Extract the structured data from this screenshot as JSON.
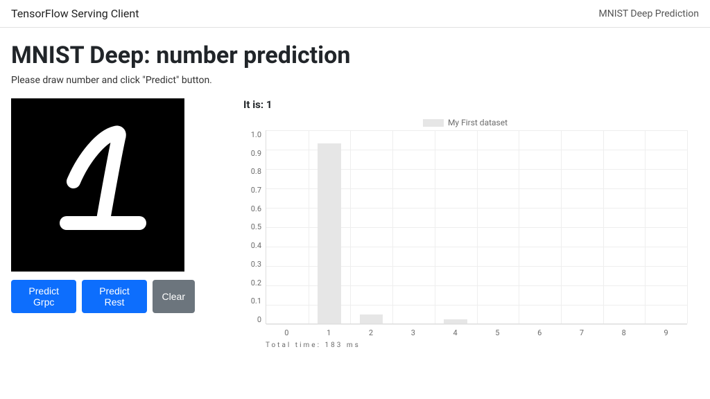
{
  "navbar": {
    "brand": "TensorFlow Serving Client",
    "nav_link": "MNIST Deep Prediction"
  },
  "page": {
    "heading": "MNIST Deep: number prediction",
    "subtitle": "Please draw number and click \"Predict\" button."
  },
  "buttons": {
    "predict_grpc": "Predict Grpc",
    "predict_rest": "Predict Rest",
    "clear": "Clear"
  },
  "result": {
    "label_prefix": "It is: ",
    "value": "1"
  },
  "legend": {
    "series_name": "My First dataset"
  },
  "timing": {
    "text": "Total time: 183 ms"
  },
  "chart_data": {
    "type": "bar",
    "categories": [
      "0",
      "1",
      "2",
      "3",
      "4",
      "5",
      "6",
      "7",
      "8",
      "9"
    ],
    "values": [
      0,
      0.93,
      0.045,
      0,
      0.02,
      0,
      0,
      0,
      0,
      0
    ],
    "title": "",
    "xlabel": "",
    "ylabel": "",
    "ylim": [
      0,
      1.0
    ],
    "y_ticks": [
      "1.0",
      "0.9",
      "0.8",
      "0.7",
      "0.6",
      "0.5",
      "0.4",
      "0.3",
      "0.2",
      "0.1",
      "0"
    ],
    "series_name": "My First dataset"
  },
  "colors": {
    "primary": "#0d6efd",
    "secondary": "#6c757d",
    "bar_fill": "#e6e6e6"
  }
}
